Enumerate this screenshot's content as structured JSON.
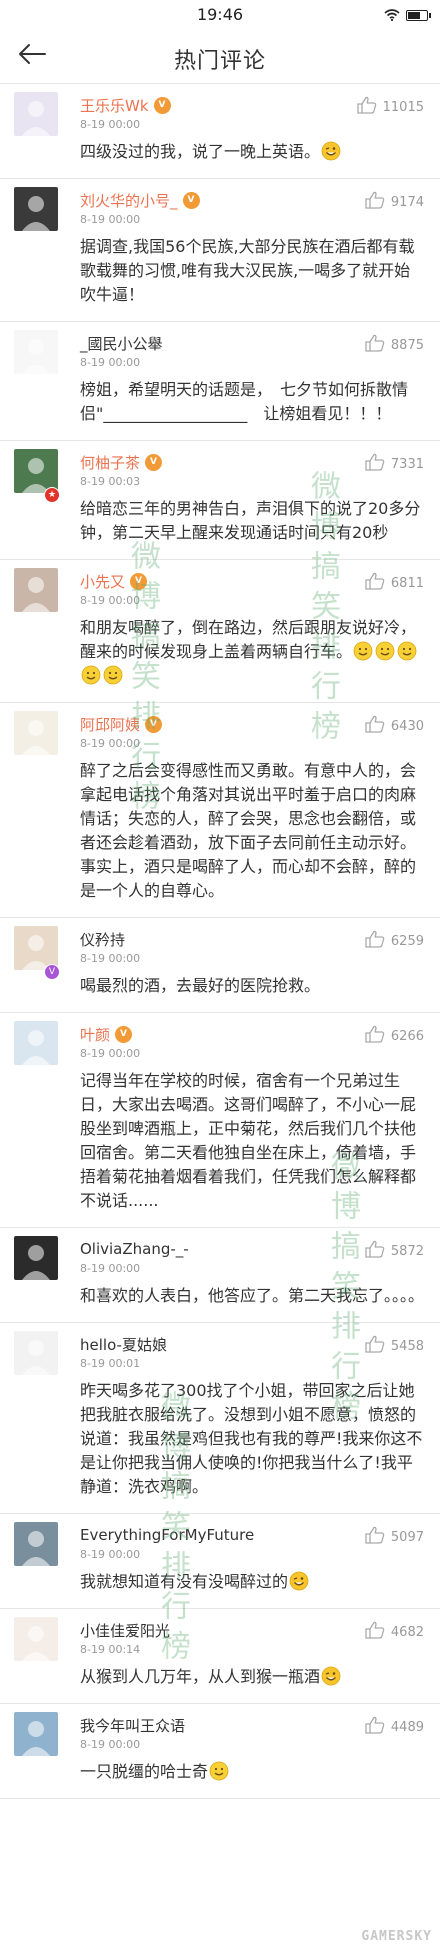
{
  "status": {
    "time": "19:46"
  },
  "nav": {
    "title": "热门评论",
    "back_icon": "arrow-left-icon"
  },
  "comments": [
    {
      "name": "王乐乐Wk",
      "vip": true,
      "time": "8-19 00:00",
      "likes": "11015",
      "content": "四级没过的我，说了一晚上英语。",
      "emoji_count": 1,
      "emoji": "wink-face"
    },
    {
      "name": "刘火华的小号_",
      "vip": true,
      "time": "8-19 00:00",
      "likes": "9174",
      "content": "据调查,我国56个民族,大部分民族在酒后都有载歌载舞的习惯,唯有我大汉民族,一喝多了就开始吹牛逼！",
      "emoji_count": 0
    },
    {
      "name": "_國民小公舉",
      "vip": false,
      "time": "8-19 00:00",
      "likes": "8875",
      "content": "榜姐，希望明天的话题是，　七夕节如何拆散情侣\"__________________　让榜姐看见！！！",
      "emoji_count": 0
    },
    {
      "name": "何柚子茶",
      "vip": true,
      "time": "8-19 00:03",
      "likes": "7331",
      "content": "给暗恋三年的男神告白，声泪俱下的说了20多分钟，第二天早上醒来发现通话时间只有20秒",
      "emoji_count": 0,
      "badge": "red"
    },
    {
      "name": "小先又",
      "vip": true,
      "time": "8-19 00:00",
      "likes": "6811",
      "content": "和朋友喝醉了，倒在路边，然后跟朋友说好冷，醒来的时候发现身上盖着两辆自行车。",
      "emoji_count": 5,
      "emoji": "grin-face"
    },
    {
      "name": "阿邱阿姨",
      "vip": true,
      "time": "8-19 00:00",
      "likes": "6430",
      "content": "醉了之后会变得感性而又勇敢。有意中人的，会拿起电话找个角落对其说出平时羞于启口的肉麻情话；失恋的人，醉了会哭，思念也会翻倍，或者还会趁着酒劲，放下面子去同前任主动示好。事实上，酒只是喝醉了人，而心却不会醉，醉的是一个人的自尊心。",
      "emoji_count": 0
    },
    {
      "name": "仪矜持",
      "vip": false,
      "time": "8-19 00:00",
      "likes": "6259",
      "content": "喝最烈的酒，去最好的医院抢救。",
      "emoji_count": 0,
      "badge": "purple"
    },
    {
      "name": "叶颜",
      "vip": true,
      "time": "8-19 00:00",
      "likes": "6266",
      "content": "记得当年在学校的时候，宿舍有一个兄弟过生日，大家出去喝酒。这哥们喝醉了，不小心一屁股坐到啤酒瓶上，正中菊花，然后我们几个扶他回宿舍。第二天看他独自坐在床上，倚着墙，手捂着菊花抽着烟看着我们，任凭我们怎么解释都不说话......",
      "emoji_count": 0
    },
    {
      "name": "OliviaZhang-_-",
      "vip": false,
      "time": "8-19 00:00",
      "likes": "5872",
      "content": "和喜欢的人表白，他答应了。第二天我忘了。。。。",
      "emoji_count": 0
    },
    {
      "name": "hello-夏姑娘",
      "vip": false,
      "time": "8-19 00:01",
      "likes": "5458",
      "content": "昨天喝多花了300找了个小姐，带回家之后让她把我脏衣服给洗了。没想到小姐不愿意，愤怒的说道：我虽然是鸡但我也有我的尊严!我来你这不是让你把我当佣人使唤的!你把我当什么了!我平静道：洗衣鸡啊。",
      "emoji_count": 0
    },
    {
      "name": "EverythingForMyFuture",
      "vip": false,
      "time": "8-19 00:00",
      "likes": "5097",
      "content": "我就想知道有没有没喝醉过的",
      "emoji_count": 1,
      "emoji": "wink-face"
    },
    {
      "name": "小佳佳爱阳光",
      "vip": false,
      "time": "8-19 00:14",
      "likes": "4682",
      "content": "从猴到人几万年，从人到猴一瓶酒",
      "emoji_count": 1,
      "emoji": "wink-face"
    },
    {
      "name": "我今年叫王众语",
      "vip": false,
      "time": "8-19 00:00",
      "likes": "4489",
      "content": "一只脱缰的哈士奇",
      "emoji_count": 1,
      "emoji": "grin-face"
    }
  ],
  "watermark": {
    "text": "微博搞笑排行榜"
  },
  "footer": {
    "logo": "GAMERSKY"
  }
}
